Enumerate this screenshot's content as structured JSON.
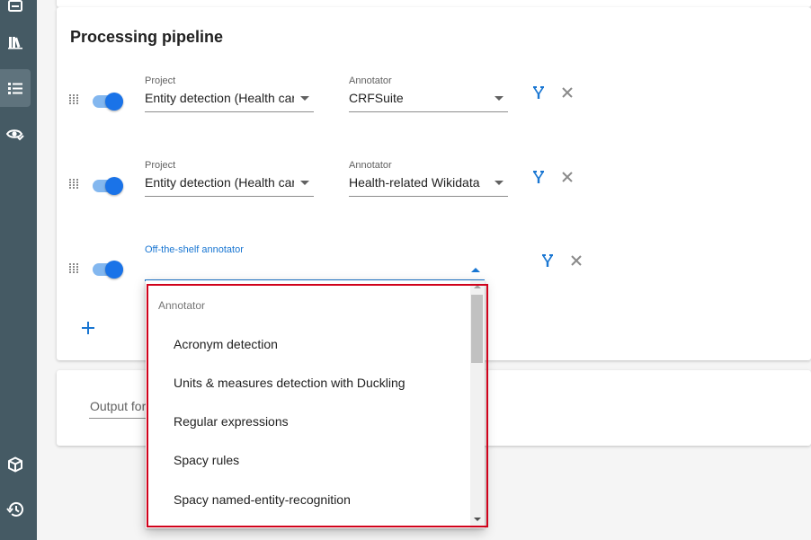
{
  "colors": {
    "sidebar": "#455a64",
    "accent": "#1a73e8",
    "highlight": "#d0021b"
  },
  "sidebar": {
    "items": [
      {
        "icon": "inbox-icon",
        "active": false
      },
      {
        "icon": "library-icon",
        "active": false
      },
      {
        "icon": "list-icon",
        "active": true
      },
      {
        "icon": "eye-check-icon",
        "active": false
      },
      {
        "icon": "cube-icon",
        "active": false
      },
      {
        "icon": "history-icon",
        "active": false
      }
    ]
  },
  "pipeline": {
    "title": "Processing pipeline",
    "steps": [
      {
        "enabled": true,
        "project_label": "Project",
        "project_value": "Entity detection (Health care)",
        "annotator_label": "Annotator",
        "annotator_value": "CRFSuite"
      },
      {
        "enabled": true,
        "project_label": "Project",
        "project_value": "Entity detection (Health care)",
        "annotator_label": "Annotator",
        "annotator_value": "Health-related Wikidata"
      },
      {
        "enabled": true,
        "annotator_label": "Off-the-shelf annotator",
        "annotator_value": ""
      }
    ],
    "add_icon": "plus-icon"
  },
  "output": {
    "label": "Output format"
  },
  "dropdown": {
    "header": "Annotator",
    "items": [
      "Acronym detection",
      "Units & measures detection with Duckling",
      "Regular expressions",
      "Spacy rules",
      "Spacy named-entity-recognition"
    ]
  }
}
